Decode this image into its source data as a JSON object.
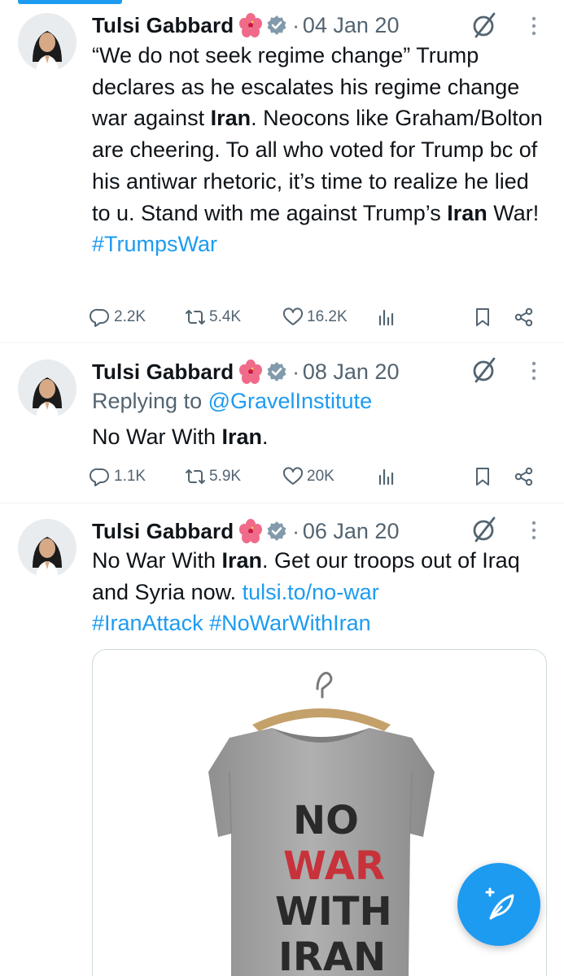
{
  "colors": {
    "accent": "#1d9bf0",
    "text": "#0f1419",
    "muted": "#536471",
    "shirt": "#a7a7a7",
    "stencil_dark": "#2a2a2a",
    "stencil_red": "#c8323a"
  },
  "tweets": [
    {
      "name": "Tulsi Gabbard",
      "separator": "·",
      "date": "04 Jan 20",
      "text": {
        "p1": "“We do not seek regime change” Trump declares as he escalates his regime change war against ",
        "b1": "Iran",
        "p2": ". Neocons like Graham/Bolton are cheering. To all who voted for Trump bc of his antiwar rhetoric, it’s time to realize he lied to u. Stand with me against Trump’s ",
        "b2": "Iran",
        "p3": " War!",
        "hashtag": "#TrumpsWar"
      },
      "stats": {
        "replies": "2.2K",
        "reposts": "5.4K",
        "likes": "16.2K"
      }
    },
    {
      "name": "Tulsi Gabbard",
      "separator": "·",
      "date": "08 Jan 20",
      "replying_prefix": "Replying to ",
      "replying_handle": "@GravelInstitute",
      "text": {
        "p1": "No War With ",
        "b1": "Iran",
        "p2": "."
      },
      "stats": {
        "replies": "1.1K",
        "reposts": "5.9K",
        "likes": "20K"
      }
    },
    {
      "name": "Tulsi Gabbard",
      "separator": "·",
      "date": "06 Jan 20",
      "text": {
        "p1": "No War With ",
        "b1": "Iran",
        "p2": ". Get our troops out of Iraq and Syria now. ",
        "link": "tulsi.to/no-war",
        "hashtags": "#IranAttack #NoWarWithIran"
      },
      "media": {
        "shirt_lines": [
          "NO",
          "WAR",
          "WITH",
          "IRAN"
        ]
      }
    }
  ],
  "icons": {
    "flower": "hibiscus-emoji",
    "verified": "verified-badge-icon",
    "grok": "grok-icon",
    "more": "more-vertical-icon",
    "reply": "reply-icon",
    "repost": "repost-icon",
    "like": "like-icon",
    "views": "views-icon",
    "bookmark": "bookmark-icon",
    "share": "share-icon",
    "compose": "compose-feather-icon"
  }
}
